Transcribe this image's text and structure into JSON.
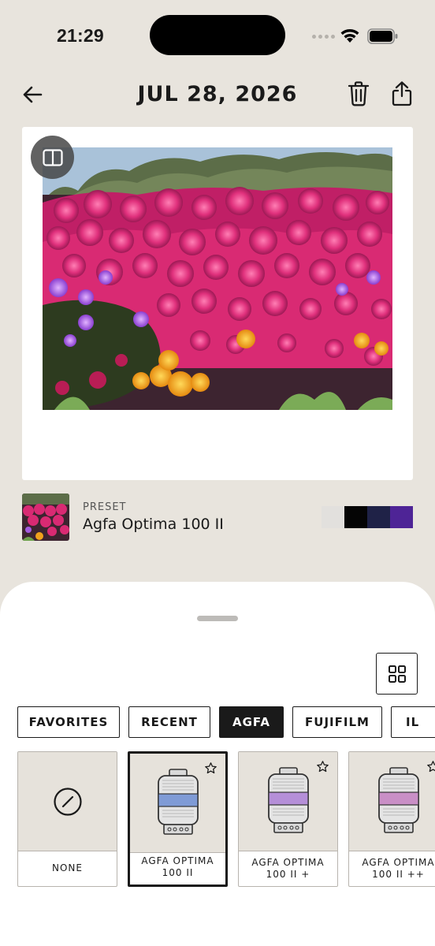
{
  "status_bar": {
    "time": "21:29"
  },
  "header": {
    "title": "JUL 28, 2026"
  },
  "preset_info": {
    "caption": "PRESET",
    "name": "Agfa Optima 100 II",
    "swatches": [
      "#e2e0dd",
      "#050505",
      "#1f2247",
      "#4e2496"
    ]
  },
  "tabs": [
    {
      "label": "FAVORITES",
      "active": false
    },
    {
      "label": "RECENT",
      "active": false
    },
    {
      "label": "AGFA",
      "active": true
    },
    {
      "label": "FUJIFILM",
      "active": false
    },
    {
      "label": "IL",
      "active": false
    }
  ],
  "presets": [
    {
      "label": "NONE",
      "icon": "none-icon",
      "selected": false
    },
    {
      "label": "AGFA OPTIMA\n100 II",
      "icon": "film-canister-icon",
      "band": "#7f9bd6",
      "selected": true
    },
    {
      "label": "AGFA OPTIMA\n100 II +",
      "icon": "film-canister-icon",
      "band": "#b58fd8",
      "selected": false
    },
    {
      "label": "AGFA OPTIMA\n100 II ++",
      "icon": "film-canister-icon",
      "band": "#c98fc6",
      "selected": false
    }
  ],
  "colors": {
    "background": "#e8e4dd",
    "accent": "#1a1a1a"
  }
}
